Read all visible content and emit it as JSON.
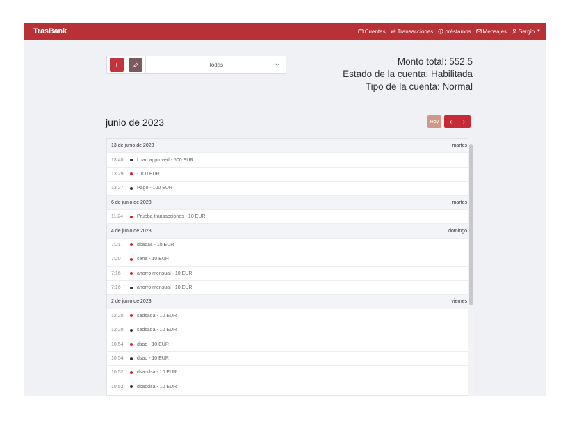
{
  "navbar": {
    "brand": "TrasBank",
    "items": [
      {
        "label": "Cuentas",
        "icon": "wallet-icon"
      },
      {
        "label": "Transacciones",
        "icon": "swap-arrows-icon"
      },
      {
        "label": "préstamos",
        "icon": "coin-icon"
      },
      {
        "label": "Mensajes",
        "icon": "envelope-icon"
      },
      {
        "label": "Sergio",
        "icon": "user-icon"
      }
    ]
  },
  "toolbar": {
    "add_label": "+",
    "filter_value": "Todas"
  },
  "summary": {
    "total": "Monto total: 552.5",
    "status": "Estado de la cuenta: Habilitada",
    "type": "Tipo de la cuenta: Normal"
  },
  "calendar": {
    "month": "junio de 2023",
    "today_label": "Hoy",
    "prev": "‹",
    "next": "›"
  },
  "colors": {
    "accent": "#b83137",
    "dot_red": "#d3222d",
    "dot_dark": "#333333"
  },
  "events": [
    {
      "kind": "day",
      "date": "13 de junio de 2023",
      "weekday": "martes"
    },
    {
      "kind": "event",
      "time": "13:40",
      "text": "Loan approved - 500 EUR",
      "dot": "dark"
    },
    {
      "kind": "event",
      "time": "13:29",
      "text": "- 100 EUR",
      "dot": "red"
    },
    {
      "kind": "event",
      "time": "13:27",
      "text": "Pago - 100 EUR",
      "dot": "dark"
    },
    {
      "kind": "day",
      "date": "6 de junio de 2023",
      "weekday": "martes"
    },
    {
      "kind": "event",
      "time": "11:24",
      "text": "Prueba transacciones - 10 EUR",
      "dot": "red"
    },
    {
      "kind": "day",
      "date": "4 de junio de 2023",
      "weekday": "domingo"
    },
    {
      "kind": "event",
      "time": "7:21",
      "text": "dsadas - 10 EUR",
      "dot": "red"
    },
    {
      "kind": "event",
      "time": "7:20",
      "text": "cena - 10 EUR",
      "dot": "red"
    },
    {
      "kind": "event",
      "time": "7:16",
      "text": "ahorro mensual - 10 EUR",
      "dot": "red"
    },
    {
      "kind": "event",
      "time": "7:16",
      "text": "ahorro mensual - 10 EUR",
      "dot": "dark"
    },
    {
      "kind": "day",
      "date": "2 de junio de 2023",
      "weekday": "viernes"
    },
    {
      "kind": "event",
      "time": "12:20",
      "text": "sadsada - 10 EUR",
      "dot": "red"
    },
    {
      "kind": "event",
      "time": "12:20",
      "text": "sadsada - 10 EUR",
      "dot": "dark"
    },
    {
      "kind": "event",
      "time": "10:54",
      "text": "dsad - 10 EUR",
      "dot": "red"
    },
    {
      "kind": "event",
      "time": "10:54",
      "text": "dsad - 10 EUR",
      "dot": "dark"
    },
    {
      "kind": "event",
      "time": "10:52",
      "text": "dsaddsa - 10 EUR",
      "dot": "red"
    },
    {
      "kind": "event",
      "time": "10:52",
      "text": "dsaddsa - 10 EUR",
      "dot": "dark"
    }
  ]
}
